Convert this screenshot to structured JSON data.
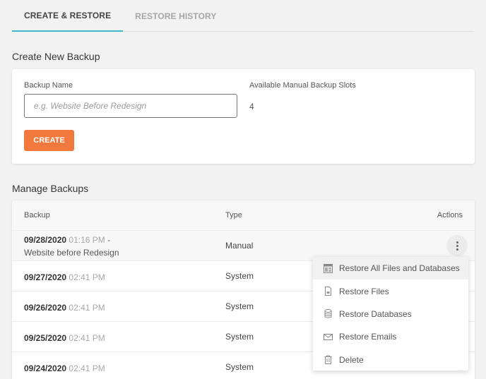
{
  "tabs": [
    {
      "label": "CREATE & RESTORE",
      "active": true
    },
    {
      "label": "RESTORE HISTORY",
      "active": false
    }
  ],
  "create": {
    "title": "Create New Backup",
    "name_label": "Backup Name",
    "name_value": "",
    "name_placeholder": "e.g. Website Before Redesign",
    "slots_label": "Available Manual Backup Slots",
    "slots_value": "4",
    "create_button": "CREATE"
  },
  "manage": {
    "title": "Manage Backups",
    "columns": {
      "backup": "Backup",
      "type": "Type",
      "actions": "Actions"
    },
    "rows": [
      {
        "date": "09/28/2020",
        "time": "01:16 PM",
        "sep": " -",
        "description": "Website before Redesign",
        "type": "Manual"
      },
      {
        "date": "09/27/2020",
        "time": "02:41 PM",
        "type": "System"
      },
      {
        "date": "09/26/2020",
        "time": "02:41 PM",
        "type": "System"
      },
      {
        "date": "09/25/2020",
        "time": "02:41 PM",
        "type": "System"
      },
      {
        "date": "09/24/2020",
        "time": "02:41 PM",
        "type": "System"
      }
    ]
  },
  "actions_menu": {
    "items": [
      {
        "label": "Restore All Files and Databases",
        "icon": "restore-all-icon"
      },
      {
        "label": "Restore Files",
        "icon": "file-icon"
      },
      {
        "label": "Restore Databases",
        "icon": "database-icon"
      },
      {
        "label": "Restore Emails",
        "icon": "envelope-icon"
      },
      {
        "label": "Delete",
        "icon": "trash-icon"
      }
    ]
  },
  "colors": {
    "accent_tab": "#3fb8cb",
    "create_button": "#f2793d",
    "background": "#f2f2f2"
  }
}
